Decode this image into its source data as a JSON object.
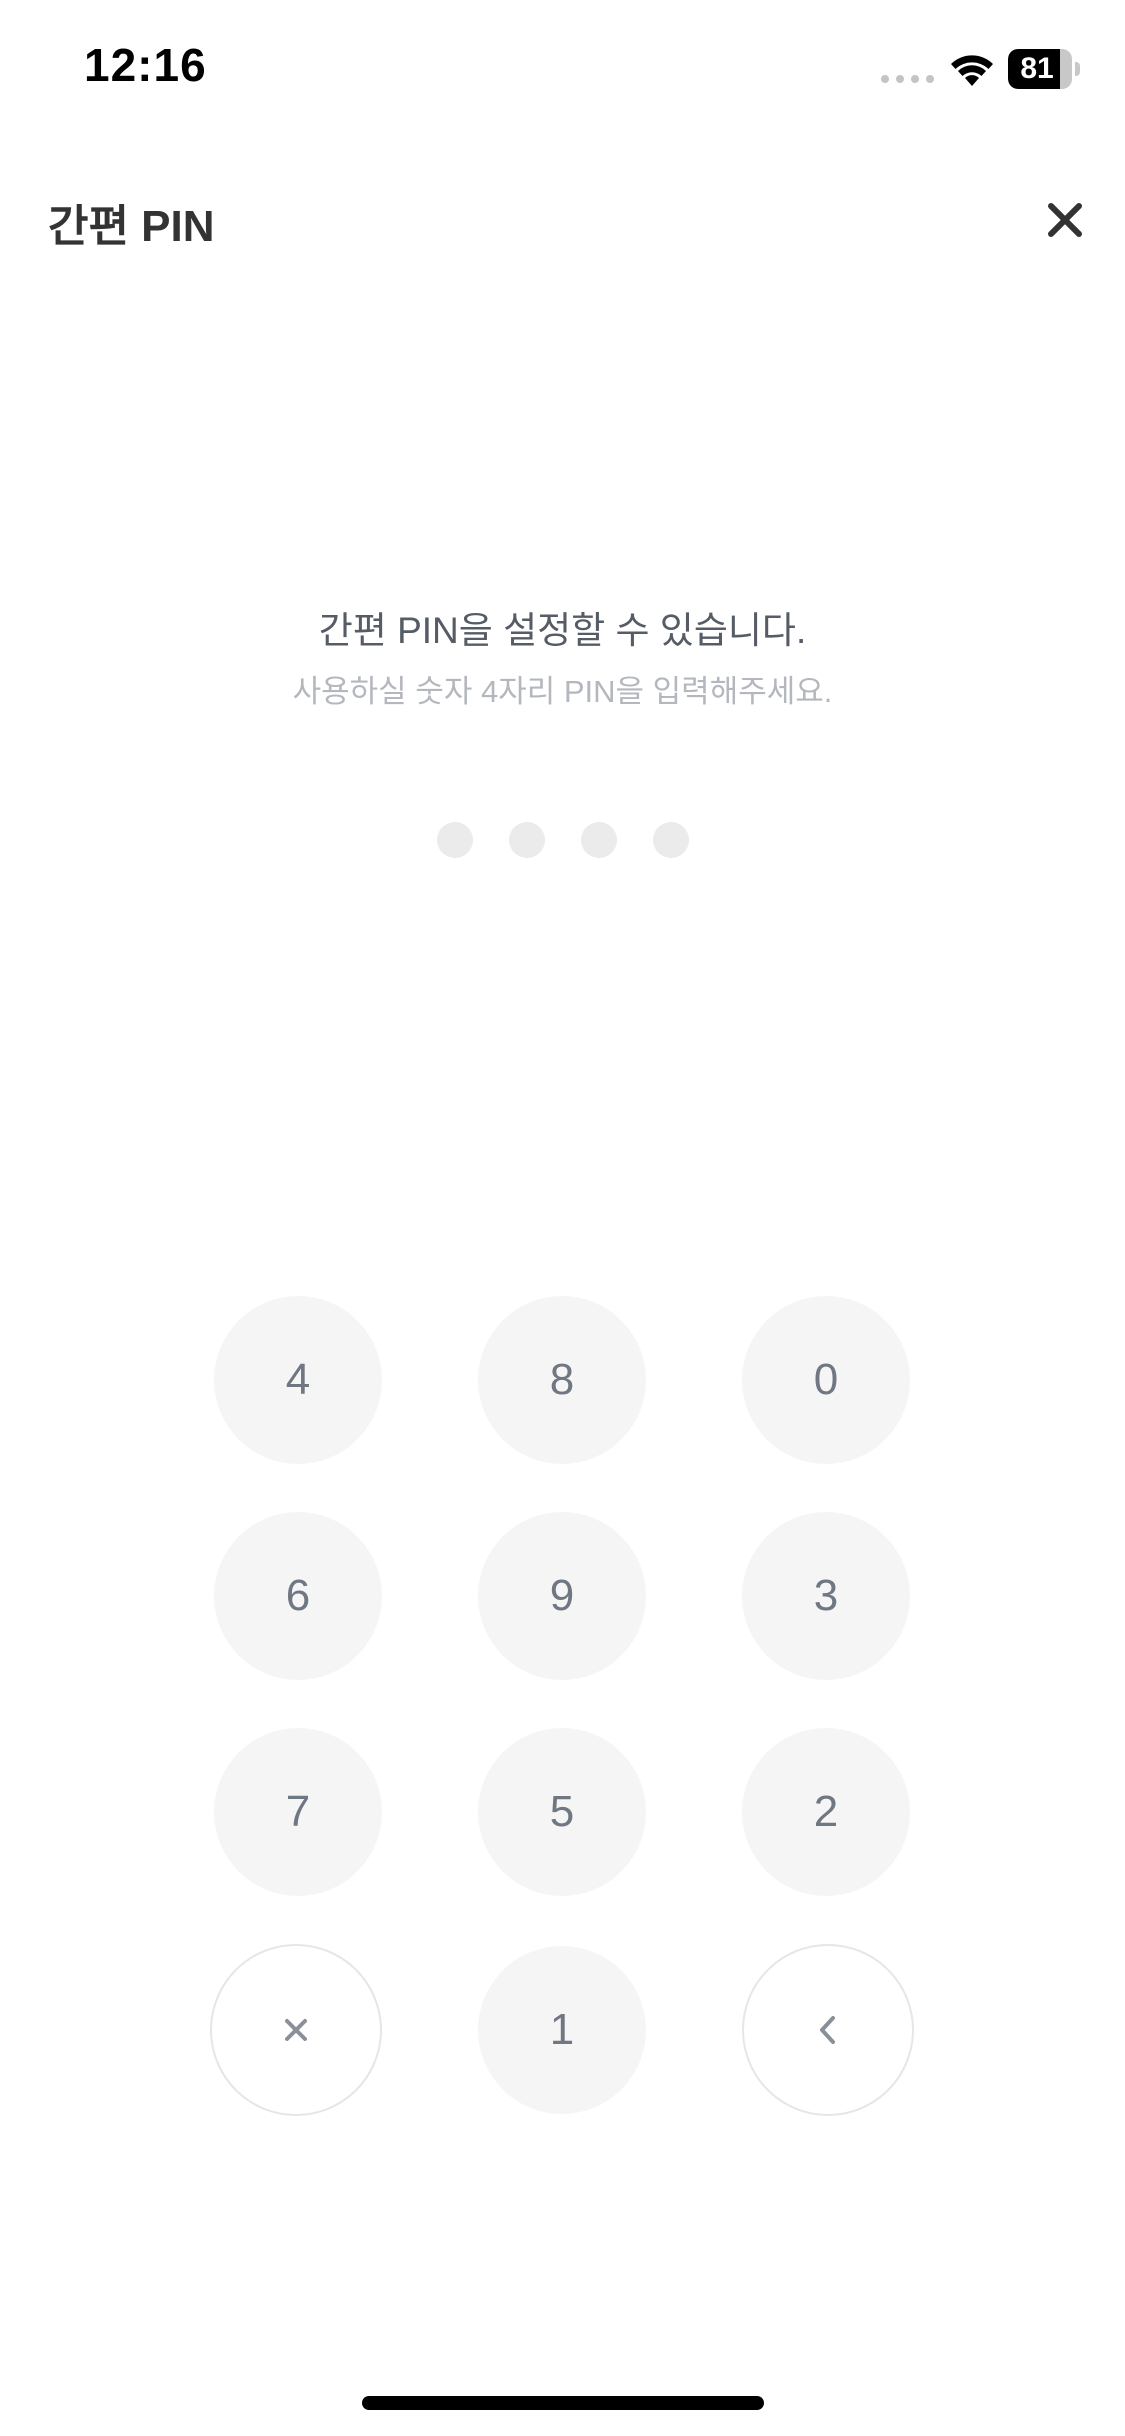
{
  "status_bar": {
    "time": "12:16",
    "battery_level": "81",
    "battery_fraction": 0.81
  },
  "header": {
    "title": "간편 PIN",
    "close_icon": "close-icon"
  },
  "prompt": {
    "title": "간편 PIN을 설정할 수 있습니다.",
    "subtitle": "사용하실 숫자 4자리 PIN을 입력해주세요."
  },
  "pin": {
    "length": 4,
    "entered": 0
  },
  "keypad": {
    "rows": [
      [
        "4",
        "8",
        "0"
      ],
      [
        "6",
        "9",
        "3"
      ],
      [
        "7",
        "5",
        "2"
      ]
    ],
    "bottom_middle": "1",
    "clear_icon": "clear-icon",
    "backspace_icon": "chevron-left-icon"
  },
  "colors": {
    "background": "#ffffff",
    "key_fill": "#f5f5f5",
    "key_text": "#6f7782",
    "dot_empty": "#ebebeb"
  }
}
